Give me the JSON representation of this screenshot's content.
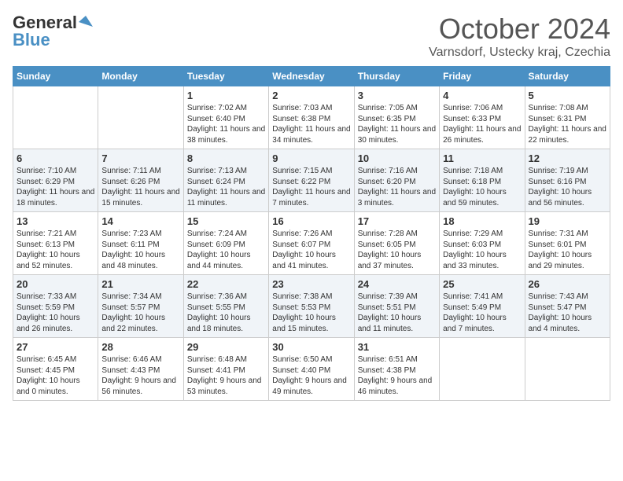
{
  "logo": {
    "general": "General",
    "blue": "Blue"
  },
  "title": "October 2024",
  "location": "Varnsdorf, Ustecky kraj, Czechia",
  "days_of_week": [
    "Sunday",
    "Monday",
    "Tuesday",
    "Wednesday",
    "Thursday",
    "Friday",
    "Saturday"
  ],
  "weeks": [
    [
      {
        "day": "",
        "content": ""
      },
      {
        "day": "",
        "content": ""
      },
      {
        "day": "1",
        "content": "Sunrise: 7:02 AM\nSunset: 6:40 PM\nDaylight: 11 hours and 38 minutes."
      },
      {
        "day": "2",
        "content": "Sunrise: 7:03 AM\nSunset: 6:38 PM\nDaylight: 11 hours and 34 minutes."
      },
      {
        "day": "3",
        "content": "Sunrise: 7:05 AM\nSunset: 6:35 PM\nDaylight: 11 hours and 30 minutes."
      },
      {
        "day": "4",
        "content": "Sunrise: 7:06 AM\nSunset: 6:33 PM\nDaylight: 11 hours and 26 minutes."
      },
      {
        "day": "5",
        "content": "Sunrise: 7:08 AM\nSunset: 6:31 PM\nDaylight: 11 hours and 22 minutes."
      }
    ],
    [
      {
        "day": "6",
        "content": "Sunrise: 7:10 AM\nSunset: 6:29 PM\nDaylight: 11 hours and 18 minutes."
      },
      {
        "day": "7",
        "content": "Sunrise: 7:11 AM\nSunset: 6:26 PM\nDaylight: 11 hours and 15 minutes."
      },
      {
        "day": "8",
        "content": "Sunrise: 7:13 AM\nSunset: 6:24 PM\nDaylight: 11 hours and 11 minutes."
      },
      {
        "day": "9",
        "content": "Sunrise: 7:15 AM\nSunset: 6:22 PM\nDaylight: 11 hours and 7 minutes."
      },
      {
        "day": "10",
        "content": "Sunrise: 7:16 AM\nSunset: 6:20 PM\nDaylight: 11 hours and 3 minutes."
      },
      {
        "day": "11",
        "content": "Sunrise: 7:18 AM\nSunset: 6:18 PM\nDaylight: 10 hours and 59 minutes."
      },
      {
        "day": "12",
        "content": "Sunrise: 7:19 AM\nSunset: 6:16 PM\nDaylight: 10 hours and 56 minutes."
      }
    ],
    [
      {
        "day": "13",
        "content": "Sunrise: 7:21 AM\nSunset: 6:13 PM\nDaylight: 10 hours and 52 minutes."
      },
      {
        "day": "14",
        "content": "Sunrise: 7:23 AM\nSunset: 6:11 PM\nDaylight: 10 hours and 48 minutes."
      },
      {
        "day": "15",
        "content": "Sunrise: 7:24 AM\nSunset: 6:09 PM\nDaylight: 10 hours and 44 minutes."
      },
      {
        "day": "16",
        "content": "Sunrise: 7:26 AM\nSunset: 6:07 PM\nDaylight: 10 hours and 41 minutes."
      },
      {
        "day": "17",
        "content": "Sunrise: 7:28 AM\nSunset: 6:05 PM\nDaylight: 10 hours and 37 minutes."
      },
      {
        "day": "18",
        "content": "Sunrise: 7:29 AM\nSunset: 6:03 PM\nDaylight: 10 hours and 33 minutes."
      },
      {
        "day": "19",
        "content": "Sunrise: 7:31 AM\nSunset: 6:01 PM\nDaylight: 10 hours and 29 minutes."
      }
    ],
    [
      {
        "day": "20",
        "content": "Sunrise: 7:33 AM\nSunset: 5:59 PM\nDaylight: 10 hours and 26 minutes."
      },
      {
        "day": "21",
        "content": "Sunrise: 7:34 AM\nSunset: 5:57 PM\nDaylight: 10 hours and 22 minutes."
      },
      {
        "day": "22",
        "content": "Sunrise: 7:36 AM\nSunset: 5:55 PM\nDaylight: 10 hours and 18 minutes."
      },
      {
        "day": "23",
        "content": "Sunrise: 7:38 AM\nSunset: 5:53 PM\nDaylight: 10 hours and 15 minutes."
      },
      {
        "day": "24",
        "content": "Sunrise: 7:39 AM\nSunset: 5:51 PM\nDaylight: 10 hours and 11 minutes."
      },
      {
        "day": "25",
        "content": "Sunrise: 7:41 AM\nSunset: 5:49 PM\nDaylight: 10 hours and 7 minutes."
      },
      {
        "day": "26",
        "content": "Sunrise: 7:43 AM\nSunset: 5:47 PM\nDaylight: 10 hours and 4 minutes."
      }
    ],
    [
      {
        "day": "27",
        "content": "Sunrise: 6:45 AM\nSunset: 4:45 PM\nDaylight: 10 hours and 0 minutes."
      },
      {
        "day": "28",
        "content": "Sunrise: 6:46 AM\nSunset: 4:43 PM\nDaylight: 9 hours and 56 minutes."
      },
      {
        "day": "29",
        "content": "Sunrise: 6:48 AM\nSunset: 4:41 PM\nDaylight: 9 hours and 53 minutes."
      },
      {
        "day": "30",
        "content": "Sunrise: 6:50 AM\nSunset: 4:40 PM\nDaylight: 9 hours and 49 minutes."
      },
      {
        "day": "31",
        "content": "Sunrise: 6:51 AM\nSunset: 4:38 PM\nDaylight: 9 hours and 46 minutes."
      },
      {
        "day": "",
        "content": ""
      },
      {
        "day": "",
        "content": ""
      }
    ]
  ]
}
